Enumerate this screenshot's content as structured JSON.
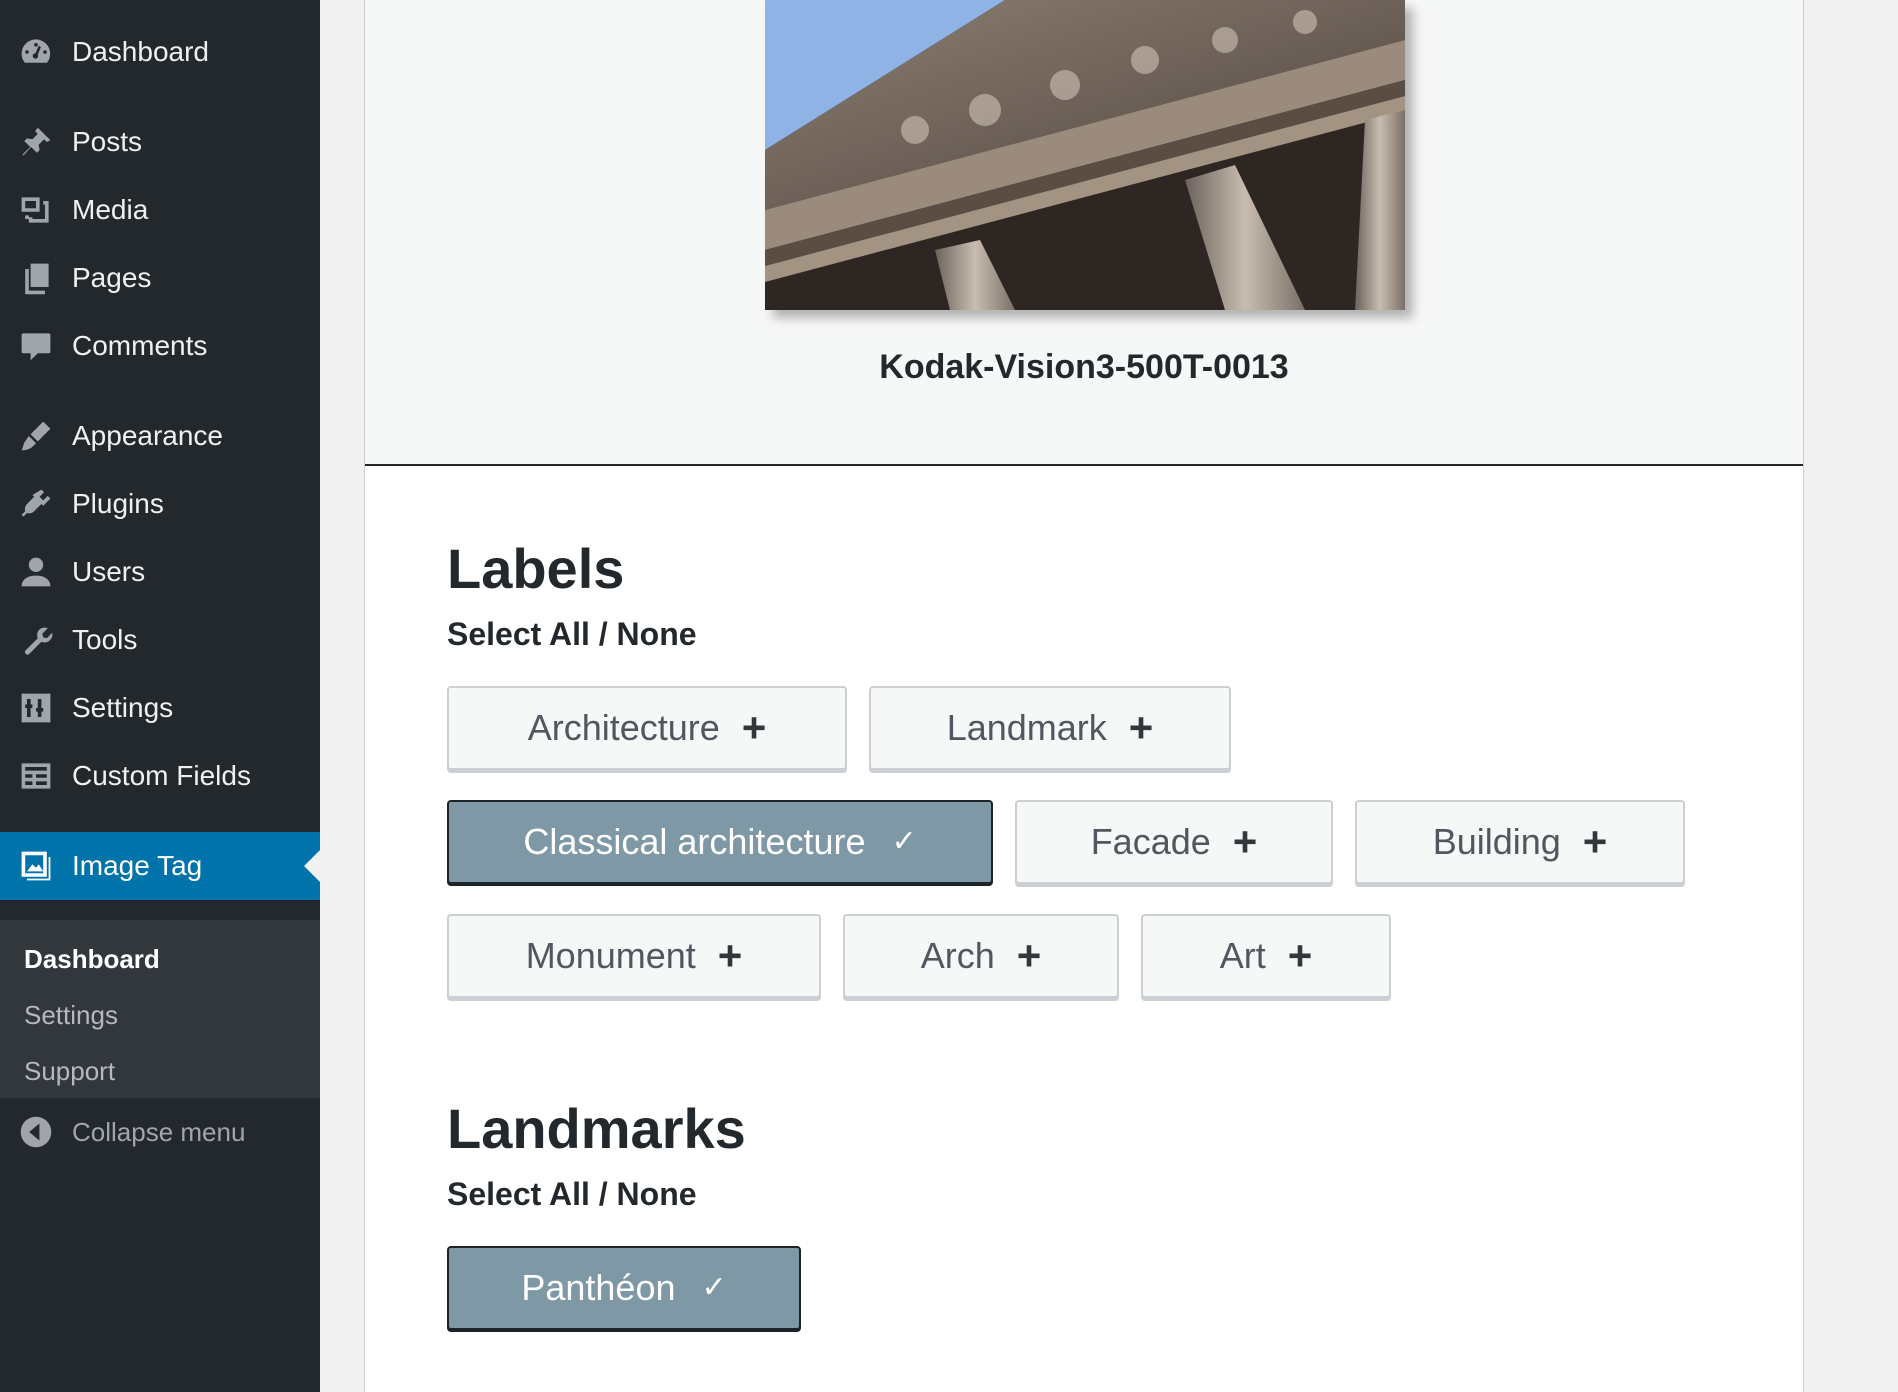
{
  "sidebar": {
    "items": [
      {
        "label": "Dashboard",
        "icon": "dashboard-icon"
      },
      {
        "label": "Posts",
        "icon": "pin-icon"
      },
      {
        "label": "Media",
        "icon": "media-icon"
      },
      {
        "label": "Pages",
        "icon": "pages-icon"
      },
      {
        "label": "Comments",
        "icon": "comment-icon"
      },
      {
        "label": "Appearance",
        "icon": "brush-icon"
      },
      {
        "label": "Plugins",
        "icon": "plugin-icon"
      },
      {
        "label": "Users",
        "icon": "user-icon"
      },
      {
        "label": "Tools",
        "icon": "wrench-icon"
      },
      {
        "label": "Settings",
        "icon": "settings-icon"
      },
      {
        "label": "Custom Fields",
        "icon": "table-icon"
      },
      {
        "label": "Image Tag",
        "icon": "image-icon"
      }
    ],
    "submenu": [
      "Dashboard",
      "Settings",
      "Support"
    ],
    "collapse_label": "Collapse menu"
  },
  "image": {
    "caption": "Kodak-Vision3-500T-0013"
  },
  "labels_section": {
    "title": "Labels",
    "select_all": "Select All",
    "separator": "/",
    "select_none": "None",
    "tags": [
      {
        "label": "Architecture",
        "selected": false
      },
      {
        "label": "Landmark",
        "selected": false
      },
      {
        "label": "Classical architecture",
        "selected": true
      },
      {
        "label": "Facade",
        "selected": false
      },
      {
        "label": "Building",
        "selected": false
      },
      {
        "label": "Monument",
        "selected": false
      },
      {
        "label": "Arch",
        "selected": false
      },
      {
        "label": "Art",
        "selected": false
      }
    ]
  },
  "landmarks_section": {
    "title": "Landmarks",
    "select_all": "Select All",
    "separator": "/",
    "select_none": "None",
    "tags": [
      {
        "label": "Panthéon",
        "selected": true
      }
    ]
  },
  "marks": {
    "add": "+",
    "check": "✓"
  },
  "colors": {
    "sidebar_bg": "#23282d",
    "accent": "#0073aa",
    "selected_tag": "#7e98a5"
  }
}
